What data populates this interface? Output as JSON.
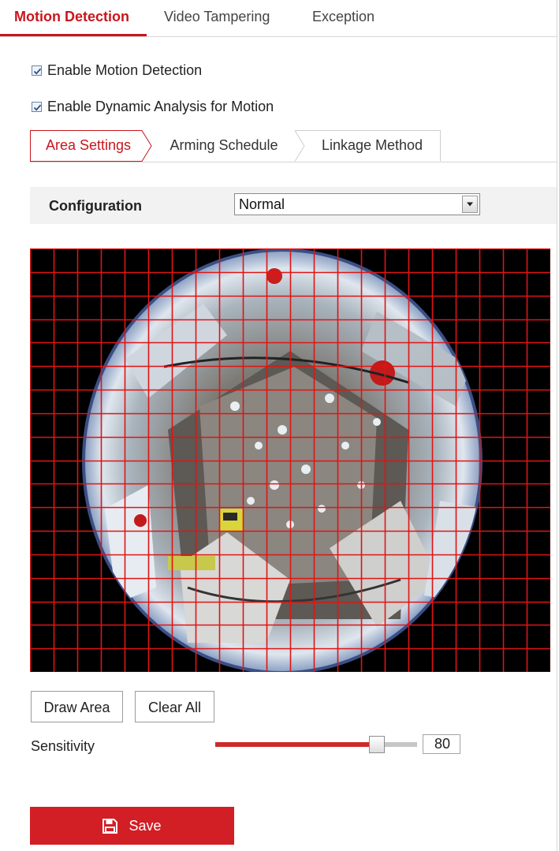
{
  "top_tabs": {
    "motion_detection": "Motion Detection",
    "video_tampering": "Video Tampering",
    "exception": "Exception"
  },
  "options": {
    "enable_motion_detection": "Enable Motion Detection",
    "enable_motion_detection_checked": true,
    "enable_dynamic_analysis": "Enable Dynamic Analysis for Motion",
    "enable_dynamic_analysis_checked": true
  },
  "sub_tabs": {
    "area_settings": "Area Settings",
    "arming_schedule": "Arming Schedule",
    "linkage_method": "Linkage Method"
  },
  "configuration": {
    "label": "Configuration",
    "selected": "Normal"
  },
  "video": {
    "grid_columns": 22,
    "grid_rows": 18
  },
  "buttons": {
    "draw_area": "Draw Area",
    "clear_all": "Clear All",
    "save": "Save"
  },
  "sensitivity": {
    "label": "Sensitivity",
    "value": "80",
    "level_percent": 80
  },
  "colors": {
    "accent": "#c8161d",
    "save_button": "#d21e25",
    "grid_line": "#e01414",
    "slider_fill": "#cc2b2b"
  }
}
